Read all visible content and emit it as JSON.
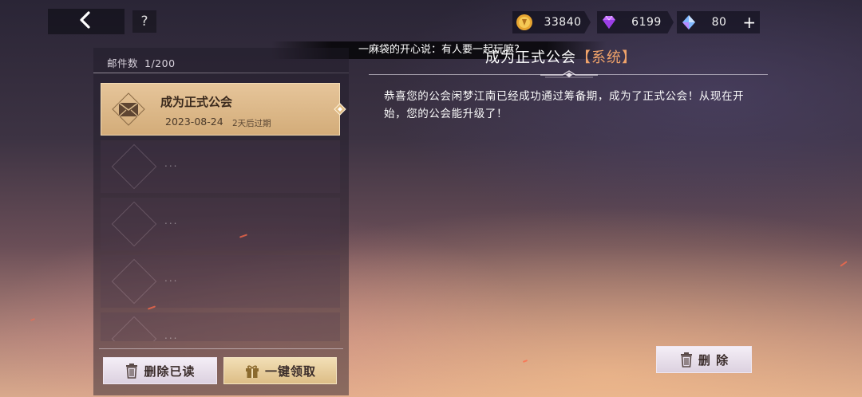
{
  "header": {
    "help_label": "?"
  },
  "currency": {
    "gold": "33840",
    "purple_gem": "6199",
    "blue_gem": "80",
    "add_label": "+"
  },
  "chat": {
    "message": "一麻袋的开心说：有人要一起玩嘛?"
  },
  "mail_list": {
    "count_label": "邮件数",
    "count_value": "1/200",
    "items": [
      {
        "title": "成为正式公会",
        "date": "2023-08-24",
        "expire": "2天后过期"
      }
    ],
    "empty_placeholder": "..."
  },
  "buttons": {
    "delete_read": "删除已读",
    "claim_all": "一键领取",
    "delete": "删 除"
  },
  "detail": {
    "title": "成为正式公会",
    "tag": "【系统】",
    "body": "恭喜您的公会闲梦江南已经成功通过筹备期，成为了正式公会！从现在开始，您的公会能升级了！"
  },
  "colors": {
    "gold_tile": "#e6c59a",
    "system_tag": "#f0a36a",
    "button_light": "#f4eef6"
  }
}
